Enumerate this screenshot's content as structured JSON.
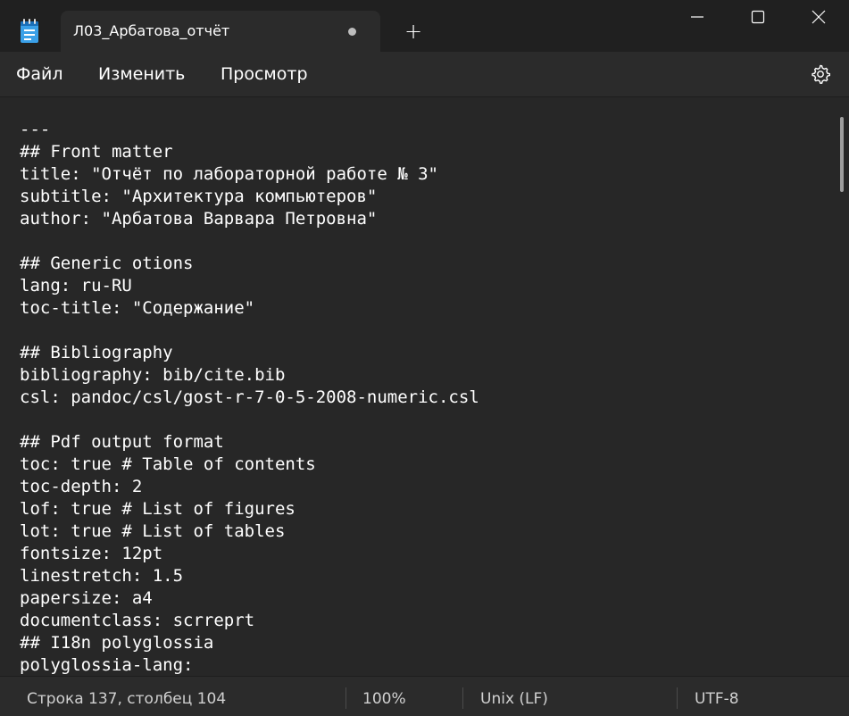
{
  "window": {
    "tab_title": "Л03_Арбатова_отчёт",
    "new_tab_symbol": "+",
    "unsaved_indicator": "dot"
  },
  "menu": {
    "file": "Файл",
    "edit": "Изменить",
    "view": "Просмотр",
    "settings_icon": "gear-icon"
  },
  "editor": {
    "lines": [
      "---",
      "## Front matter",
      "title: \"Отчёт по лабораторной работе № 3\"",
      "subtitle: \"Архитектура компьютеров\"",
      "author: \"Арбатова Варвара Петровна\"",
      "",
      "## Generic otions",
      "lang: ru-RU",
      "toc-title: \"Содержание\"",
      "",
      "## Bibliography",
      "bibliography: bib/cite.bib",
      "csl: pandoc/csl/gost-r-7-0-5-2008-numeric.csl",
      "",
      "## Pdf output format",
      "toc: true # Table of contents",
      "toc-depth: 2",
      "lof: true # List of figures",
      "lot: true # List of tables",
      "fontsize: 12pt",
      "linestretch: 1.5",
      "papersize: a4",
      "documentclass: scrreprt",
      "## I18n polyglossia",
      "polyglossia-lang:"
    ]
  },
  "status": {
    "position": "Строка 137, столбец 104",
    "zoom": "100%",
    "line_endings": "Unix (LF)",
    "encoding": "UTF-8"
  },
  "colors": {
    "titlebar": "#202020",
    "tab": "#2b2b2b",
    "editor_bg": "#272727",
    "text": "#ffffff"
  }
}
